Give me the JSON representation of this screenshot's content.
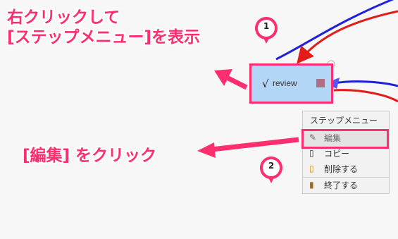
{
  "annotations": {
    "main_instruction": "右クリックして\n[ステップメニュー]を表示",
    "edit_instruction": "[編集] をクリック"
  },
  "badges": {
    "step1": "1",
    "step2": "2"
  },
  "step_node": {
    "label": "review",
    "check": "√"
  },
  "context_menu": {
    "title": "ステップメニュー",
    "items": [
      {
        "label": "編集",
        "icon": "pencil-icon"
      },
      {
        "label": "コピー",
        "icon": "page-icon"
      },
      {
        "label": "削除する",
        "icon": "delete-page-icon"
      },
      {
        "label": "終了する",
        "icon": "door-icon"
      }
    ]
  },
  "colors": {
    "accent": "#ff2f6f",
    "node_fill": "#b4d6f6",
    "arrow_blue": "#1f1fe0",
    "arrow_red": "#e31b1b"
  }
}
